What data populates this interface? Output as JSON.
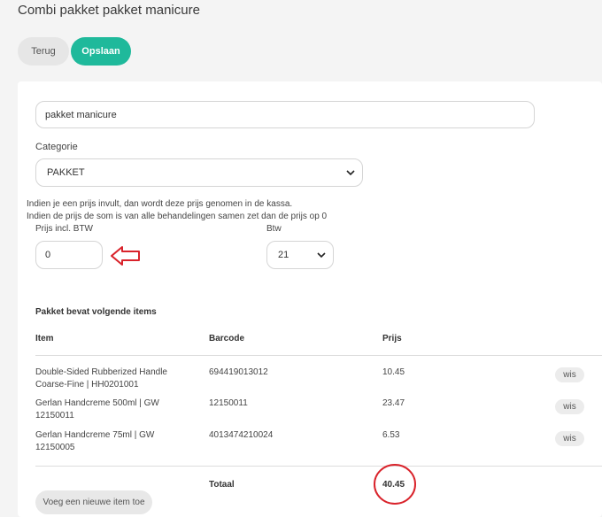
{
  "header": {
    "title": "Combi pakket pakket manicure"
  },
  "toolbar": {
    "back_label": "Terug",
    "save_label": "Opslaan"
  },
  "form": {
    "name_value": "pakket manicure",
    "category_label": "Categorie",
    "category_value": "PAKKET",
    "info_line1": "Indien je een prijs invult, dan wordt deze prijs genomen in de kassa.",
    "info_line2": "Indien de prijs de som is van alle behandelingen samen zet dan de prijs op 0",
    "price_label": "Prijs incl. BTW",
    "price_value": "0",
    "btw_label": "Btw",
    "btw_value": "21"
  },
  "package": {
    "title": "Pakket bevat volgende items",
    "columns": {
      "item": "Item",
      "barcode": "Barcode",
      "price": "Prijs"
    },
    "items": [
      {
        "name_line1": "Double-Sided Rubberized Handle",
        "name_line2": "Coarse-Fine | HH0201001",
        "barcode": "694419013012",
        "price": "10.45",
        "delete_label": "wis"
      },
      {
        "name_line1": "Gerlan Handcreme 500ml | GW",
        "name_line2": "12150011",
        "barcode": "12150011",
        "price": "23.47",
        "delete_label": "wis"
      },
      {
        "name_line1": "Gerlan Handcreme 75ml | GW",
        "name_line2": "12150005",
        "barcode": "4013474210024",
        "price": "6.53",
        "delete_label": "wis"
      }
    ],
    "total_label": "Totaal",
    "total_value": "40.45",
    "add_item_label": "Voeg een nieuwe item toe"
  },
  "annotations": {
    "arrow_color": "#d9232b",
    "circle_color": "#d9232b"
  },
  "colors": {
    "accent": "#1fb99b"
  }
}
